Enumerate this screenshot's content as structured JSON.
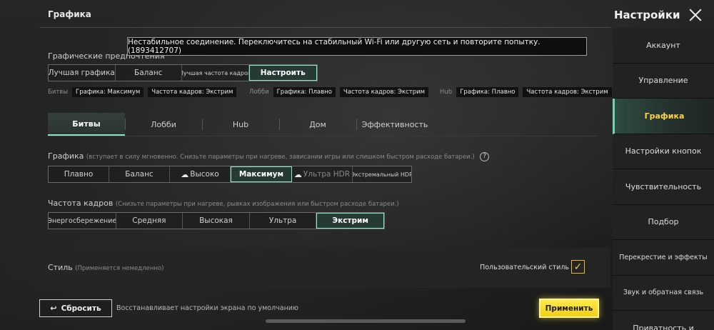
{
  "header": {
    "title": "Графика",
    "settings_title": "Настройки"
  },
  "sidebar": {
    "items": [
      {
        "label": "Аккаунт"
      },
      {
        "label": "Управление"
      },
      {
        "label": "Графика"
      },
      {
        "label": "Настройки кнопок"
      },
      {
        "label": "Чувствительность"
      },
      {
        "label": "Подбор"
      },
      {
        "label": "Перекрестие и эффекты"
      },
      {
        "label": "Звук и обратная связь"
      },
      {
        "label": "Приватность и"
      }
    ]
  },
  "graphics_pref": {
    "label": "Графические предпочтения",
    "options": [
      "Лучшая графика",
      "Баланс",
      "Лучшая частота кадров",
      "Настроить"
    ],
    "selected": "Настроить"
  },
  "summary": {
    "battles": {
      "label": "Битвы",
      "graphics": "Графика: Максимум",
      "fps": "Частота кадров: Экстрим"
    },
    "lobby": {
      "label": "Лобби",
      "graphics": "Графика: Плавно",
      "fps": "Частота кадров: Экстрим"
    },
    "hub": {
      "label": "Hub",
      "graphics": "Графика: Плавно",
      "fps": "Частота кадров: Экстрим"
    }
  },
  "tabs": [
    "Битвы",
    "Лобби",
    "Hub",
    "Дом",
    "Эффективность"
  ],
  "active_tab": "Битвы",
  "graphics": {
    "label": "Графика",
    "hint": "(вступает в силу мгновенно. Снизьте параметры при нагреве, зависании игры или слишком быстром расходе батареи.)",
    "options": [
      "Плавно",
      "Баланс",
      "Высоко",
      "Максимум",
      "Ультра HDR",
      "Экстремальный HDR"
    ],
    "selected": "Максимум"
  },
  "frame_rate": {
    "label": "Частота кадров",
    "hint": "(Снизьте параметры при нагреве, рывках изображения или быстром расходе батареи.)",
    "options": [
      "Энергосбережение",
      "Средняя",
      "Высокая",
      "Ультра",
      "Экстрим"
    ],
    "selected": "Экстрим"
  },
  "style": {
    "label": "Стиль",
    "hint": "(Применяется немедленно)",
    "custom_label": "Пользовательский стиль",
    "custom_checked": true
  },
  "footer": {
    "reset_label": "Сбросить",
    "reset_desc": "Восстанавливает настройки экрана по умолчанию",
    "apply_label": "Применить"
  },
  "toast": {
    "message": "Нестабильное соединение. Переключитесь на стабильный Wi-Fi или другую сеть и повторите попытку.(1893412707)"
  },
  "colors": {
    "accent": "#8fe3c6",
    "apply": "#f2cf16",
    "active_sidebar_text": "#ffd24a"
  }
}
